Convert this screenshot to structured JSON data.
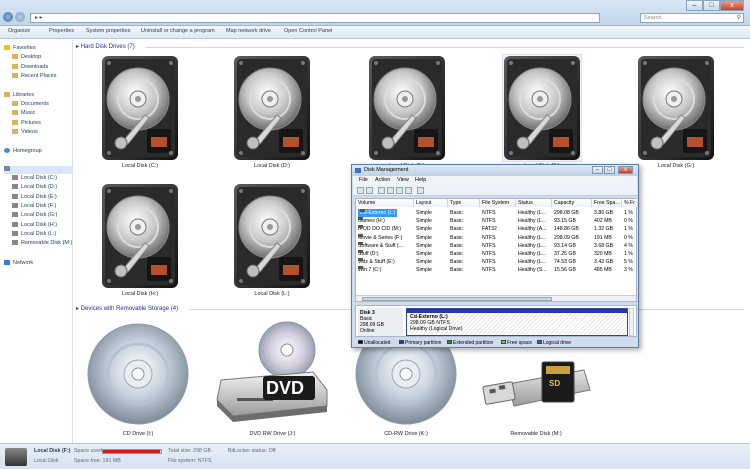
{
  "window": {
    "search_placeholder": "Search",
    "controls": {
      "minimize": "–",
      "maximize": "□",
      "close": "x"
    }
  },
  "toolbar": {
    "items": [
      "Organize",
      "Properties",
      "System properties",
      "Uninstall or change a program",
      "Map network drive",
      "Open Control Panel"
    ]
  },
  "nav": {
    "favorites": "Favorites",
    "desktop": "Desktop",
    "downloads": "Downloads",
    "recent": "Recent Places",
    "libraries": "Libraries",
    "documents": "Documents",
    "music": "Music",
    "pictures": "Pictures",
    "videos": "Videos",
    "homegroup": "Homegroup",
    "drives": [
      "Local Disk (C:)",
      "Local Disk (D:)",
      "Local Disk (E:)",
      "Local Disk (F:)",
      "Local Disk (G:)",
      "Local Disk (H:)",
      "Local Disk (L:)",
      "Removable Disk (M:)"
    ],
    "network": "Network"
  },
  "content": {
    "hdd_section": "Hard Disk Drives (7)",
    "hdd_labels": [
      "Local Disk (C:)",
      "Local Disk (D:)",
      "Local Disk (E:)",
      "Local Disk (F:)",
      "Local Disk (G:)",
      "Local Disk (H:)",
      "Local Disk (L:)"
    ],
    "removable_section": "Devices with Removable Storage (4)",
    "removable_labels": [
      "CD Drive (I:)",
      "DVD RW Drive (J:)",
      "CD-RW Drive (K:)",
      "Removable Disk (M:)"
    ],
    "dvd_text": "DVD"
  },
  "disk_mgmt": {
    "title": "Disk Management",
    "menu": [
      "File",
      "Action",
      "View",
      "Help"
    ],
    "columns": [
      "Volume",
      "Layout",
      "Type",
      "File System",
      "Status",
      "Capacity",
      "Free Spa...",
      "% Fr"
    ],
    "rows": [
      [
        "Cd-Externo (L:)",
        "Simple",
        "Basic",
        "NTFS",
        "Healthy (L...",
        "298.08 GB",
        "3.86 GB",
        "1 %"
      ],
      [
        "Games (H:)",
        "Simple",
        "Basic",
        "NTFS",
        "Healthy (L...",
        "93.15 GB",
        "402 MB",
        "0 %"
      ],
      [
        "IPOD DO CID (M:)",
        "Simple",
        "Basic",
        "FAT32",
        "Healthy (A...",
        "148.86 GB",
        "1.32 GB",
        "1 %"
      ],
      [
        "Movie & Series (F:)",
        "Simple",
        "Basic",
        "NTFS",
        "Healthy (L...",
        "298.09 GB",
        "191 MB",
        "0 %"
      ],
      [
        "Software & Stuff (...",
        "Simple",
        "Basic",
        "NTFS",
        "Healthy (L...",
        "93.14 GB",
        "3.68 GB",
        "4 %"
      ],
      [
        "Stuff (D:)",
        "Simple",
        "Basic",
        "NTFS",
        "Healthy (L...",
        "37.25 GB",
        "320 MB",
        "1 %"
      ],
      [
        "Vidz & Stuff (E:)",
        "Simple",
        "Basic",
        "NTFS",
        "Healthy (L...",
        "74.53 GB",
        "3.42 GB",
        "5 %"
      ],
      [
        "Win 7 (C:)",
        "Simple",
        "Basic",
        "NTFS",
        "Healthy (S...",
        "15.56 GB",
        "485 MB",
        "3 %"
      ]
    ],
    "disk": {
      "name": "Disk 3",
      "type": "Basic",
      "size": "298.09 GB",
      "status": "Online"
    },
    "partition": {
      "name": "Cd-Externo (L:)",
      "size": "298.09 GB NTFS",
      "status": "Healthy (Logical Drive)"
    },
    "legend": [
      {
        "label": "Unallocated",
        "color": "#000000"
      },
      {
        "label": "Primary partition",
        "color": "#2533b5"
      },
      {
        "label": "Extended partition",
        "color": "#2e8b2e"
      },
      {
        "label": "Free space",
        "color": "#6fd14f"
      },
      {
        "label": "Logical drive",
        "color": "#3b5fd9"
      }
    ]
  },
  "details": {
    "drive_name": "Local Disk (F:)",
    "drive_type": "Local Disk",
    "space_used_label": "Space used:",
    "space_used_fraction": 0.99,
    "space_free_label": "Space free: 191 MB",
    "total_size_label": "Total size: 298 GB",
    "file_system_label": "File system: NTFS",
    "bitlocker_label": "BitLocker status: Off"
  }
}
